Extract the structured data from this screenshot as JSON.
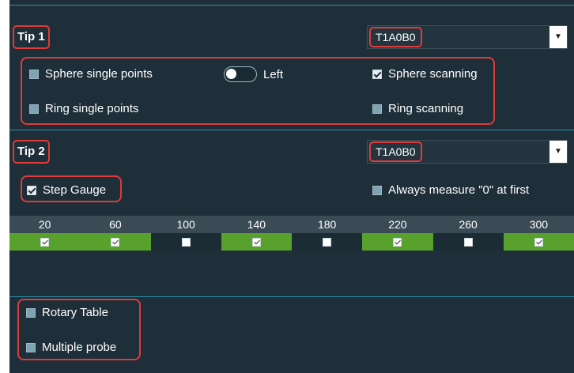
{
  "tip1": {
    "label": "Tip 1",
    "dropdown_value": "T1A0B0",
    "options": {
      "sphere_single_points": {
        "label": "Sphere single points",
        "checked": false
      },
      "toggle": {
        "label": "Left",
        "on": false
      },
      "sphere_scanning": {
        "label": "Sphere scanning",
        "checked": true
      },
      "ring_single_points": {
        "label": "Ring single points",
        "checked": false
      },
      "ring_scanning": {
        "label": "Ring scanning",
        "checked": false
      }
    }
  },
  "tip2": {
    "label": "Tip 2",
    "dropdown_value": "T1A0B0",
    "step_gauge": {
      "label": "Step Gauge",
      "checked": true
    },
    "always_measure": {
      "label": "Always measure \"0\" at first",
      "checked": false
    }
  },
  "grid": {
    "columns": [
      "20",
      "60",
      "100",
      "140",
      "180",
      "220",
      "260",
      "300"
    ],
    "checked": [
      true,
      true,
      false,
      true,
      false,
      true,
      false,
      true
    ],
    "highlighted": [
      true,
      true,
      false,
      true,
      false,
      true,
      false,
      true
    ]
  },
  "bottom": {
    "rotary_table": {
      "label": "Rotary Table",
      "checked": false
    },
    "multiple_probe": {
      "label": "Multiple probe",
      "checked": false
    }
  },
  "colors": {
    "panel_bg": "#1f2f3a",
    "accent_line": "#2e8fb0",
    "highlight_red": "#e03a3a",
    "cell_green": "#57a12c"
  }
}
